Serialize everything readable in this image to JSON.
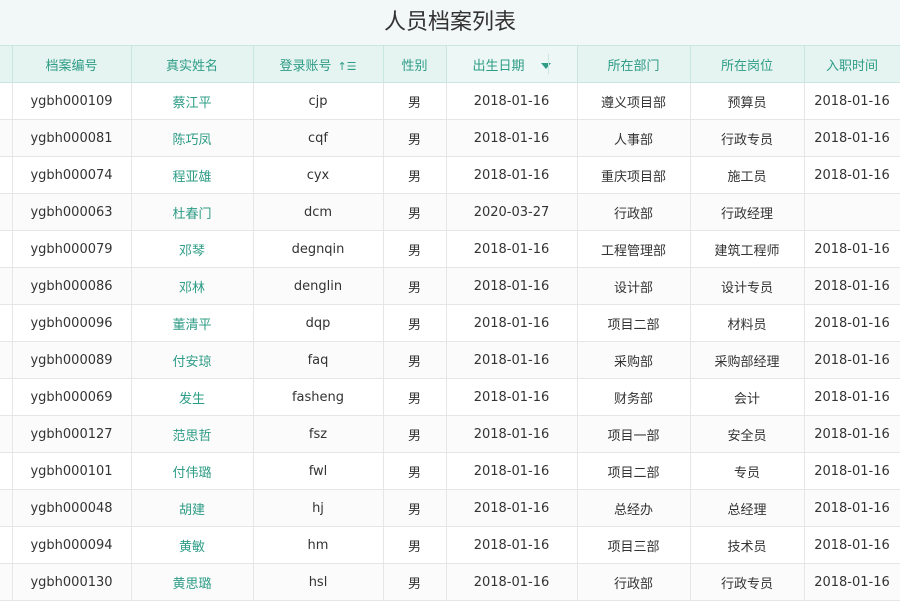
{
  "page": {
    "title": "人员档案列表"
  },
  "table": {
    "headers": [
      "档案编号",
      "真实姓名",
      "登录账号",
      "性别",
      "出生日期",
      "所在部门",
      "所在岗位",
      "入职时间"
    ],
    "sort_icon": "sort-ascending-icon",
    "filter_icon": "dropdown-filter-icon",
    "rows": [
      [
        "ygbh000109",
        "蔡江平",
        "cjp",
        "男",
        "2018-01-16",
        "遵义项目部",
        "预算员",
        "2018-01-16"
      ],
      [
        "ygbh000081",
        "陈巧凤",
        "cqf",
        "男",
        "2018-01-16",
        "人事部",
        "行政专员",
        "2018-01-16"
      ],
      [
        "ygbh000074",
        "程亚雄",
        "cyx",
        "男",
        "2018-01-16",
        "重庆项目部",
        "施工员",
        "2018-01-16"
      ],
      [
        "ygbh000063",
        "杜春门",
        "dcm",
        "男",
        "2020-03-27",
        "行政部",
        "行政经理",
        ""
      ],
      [
        "ygbh000079",
        "邓琴",
        "degnqin",
        "男",
        "2018-01-16",
        "工程管理部",
        "建筑工程师",
        "2018-01-16"
      ],
      [
        "ygbh000086",
        "邓林",
        "denglin",
        "男",
        "2018-01-16",
        "设计部",
        "设计专员",
        "2018-01-16"
      ],
      [
        "ygbh000096",
        "董清平",
        "dqp",
        "男",
        "2018-01-16",
        "项目二部",
        "材料员",
        "2018-01-16"
      ],
      [
        "ygbh000089",
        "付安琼",
        "faq",
        "男",
        "2018-01-16",
        "采购部",
        "采购部经理",
        "2018-01-16"
      ],
      [
        "ygbh000069",
        "发生",
        "fasheng",
        "男",
        "2018-01-16",
        "财务部",
        "会计",
        "2018-01-16"
      ],
      [
        "ygbh000127",
        "范思哲",
        "fsz",
        "男",
        "2018-01-16",
        "项目一部",
        "安全员",
        "2018-01-16"
      ],
      [
        "ygbh000101",
        "付伟璐",
        "fwl",
        "男",
        "2018-01-16",
        "项目二部",
        "专员",
        "2018-01-16"
      ],
      [
        "ygbh000048",
        "胡建",
        "hj",
        "男",
        "2018-01-16",
        "总经办",
        "总经理",
        "2018-01-16"
      ],
      [
        "ygbh000094",
        "黄敏",
        "hm",
        "男",
        "2018-01-16",
        "项目三部",
        "技术员",
        "2018-01-16"
      ],
      [
        "ygbh000130",
        "黄思璐",
        "hsl",
        "男",
        "2018-01-16",
        "行政部",
        "行政专员",
        "2018-01-16"
      ]
    ]
  }
}
